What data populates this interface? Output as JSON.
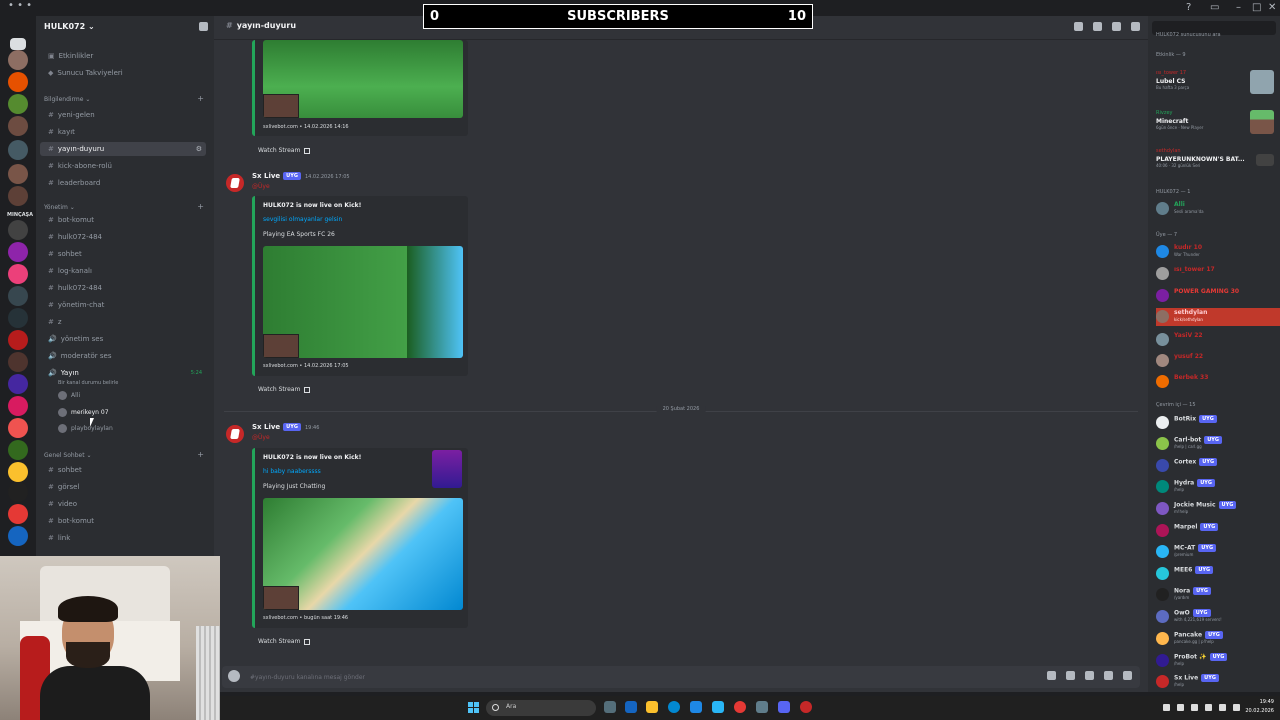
{
  "overlay": {
    "left": "0",
    "center": "SUBSCRIBERS",
    "right": "10"
  },
  "guild": {
    "name": "HULK072 ⌄"
  },
  "channels": {
    "top": [
      "Etkinlikler",
      "Sunucu Takviyeleri"
    ],
    "cat1": "Bilgilendirme ⌄",
    "cat1_items": [
      "yeni-gelen",
      "kayıt",
      "yayın-duyuru",
      "kick-abone-rolü",
      "leaderboard"
    ],
    "cat2": "Yönetim ⌄",
    "cat2_items": [
      "bot-komut",
      "hulk072-484",
      "sohbet",
      "log-kanalı",
      "hulk072-484",
      "yönetim-chat",
      "z",
      "yönetim ses",
      "moderatör ses"
    ],
    "voice": {
      "name": "Yayın",
      "status": "Bir kanal durumu belirle",
      "time": "5:24",
      "users": [
        "Alli",
        "merikeyn 07",
        "playboylaylan"
      ]
    },
    "cat3": "Genel Sohbet ⌄",
    "cat3_items": [
      "sohbet",
      "görsel",
      "video",
      "bot-komut",
      "link"
    ]
  },
  "header": {
    "channel": "yayın-duyuru"
  },
  "messages": [
    {
      "footer": "sxlivebot.com • 14.02.2026 14:16",
      "watch": "Watch Stream"
    },
    {
      "author": "Sx Live",
      "badge": "UYG",
      "time": "14.02.2026 17:05",
      "role": "@Üye",
      "title": "HULK072 is now live on Kick!",
      "link": "sevgilisi olmayanlar gelsin",
      "desc": "Playing EA Sports FC 26",
      "footer": "sxlivebot.com • 14.02.2026 17:05",
      "watch": "Watch Stream"
    },
    {
      "author": "Sx Live",
      "badge": "UYG",
      "time": "19:46",
      "role": "@Üye",
      "title": "HULK072 is now live on Kick!",
      "link": "hi baby naaberssss",
      "desc": "Playing Just Chatting",
      "footer": "sxlivebot.com • bugün saat 19:46",
      "watch": "Watch Stream"
    }
  ],
  "date_divider": "20 Şubat 2026",
  "composer": {
    "placeholder": "#yayın-duyuru kanalına mesaj gönder"
  },
  "members": {
    "search_placeholder": "HULK072 sunucusunu ara",
    "activity_header": "Etkinlik — 9",
    "activities": [
      {
        "who": "ısı_tower 17",
        "name": "Lubel CS",
        "sub": "Bu hafta 3 parça"
      },
      {
        "who": "Rivzey",
        "name": "Minecraft",
        "sub": "6gün önce · New Player"
      },
      {
        "who": "sethdylan",
        "name": "PLAYERUNKNOWN'S BAT...",
        "sub": "40:06 · 32 günlük Seri"
      }
    ],
    "group1": "HULK072 — 1",
    "group1_members": [
      {
        "name": "Alli",
        "sub": "Sesli arama'da"
      }
    ],
    "group2": "Üye — 7",
    "group2_members": [
      {
        "name": "kudır 10",
        "sub": "War Thunder"
      },
      {
        "name": "ısı_tower 17",
        "sub": ""
      },
      {
        "name": "POWER GAMING 30",
        "sub": ""
      },
      {
        "name": "sethdylan",
        "sub": "kick/sethdylan"
      },
      {
        "name": "YasiV 22",
        "sub": ""
      },
      {
        "name": "yusuf 22",
        "sub": ""
      },
      {
        "name": "Berbek 33",
        "sub": ""
      }
    ],
    "group3": "Çevrim içi — 15",
    "group3_members": [
      {
        "name": "BotRix",
        "sub": ""
      },
      {
        "name": "Carl-bot",
        "sub": "/help | carl.gg"
      },
      {
        "name": "Cortex",
        "sub": ""
      },
      {
        "name": "Hydra",
        "sub": "/help"
      },
      {
        "name": "Jockie Music",
        "sub": "m!help"
      },
      {
        "name": "Marpel",
        "sub": ""
      },
      {
        "name": "MC-AT",
        "sub": "/premium"
      },
      {
        "name": "MEE6",
        "sub": ""
      },
      {
        "name": "Nora",
        "sub": "/yardım"
      },
      {
        "name": "OwO",
        "sub": "with 4,221,619 servers!"
      },
      {
        "name": "Pancake",
        "sub": "pancake.gg | p!help"
      },
      {
        "name": "ProBot ✨",
        "sub": "/help"
      },
      {
        "name": "Sx Live",
        "sub": "/help"
      }
    ],
    "bot_badge": "UYG"
  },
  "taskbar": {
    "search": "Ara",
    "time": "19:49",
    "date": "20.02.2026"
  },
  "colors": {
    "accent": "#5865f2",
    "embed_border": "#23a55a",
    "link": "#00a8fc",
    "red": "#c62828"
  }
}
